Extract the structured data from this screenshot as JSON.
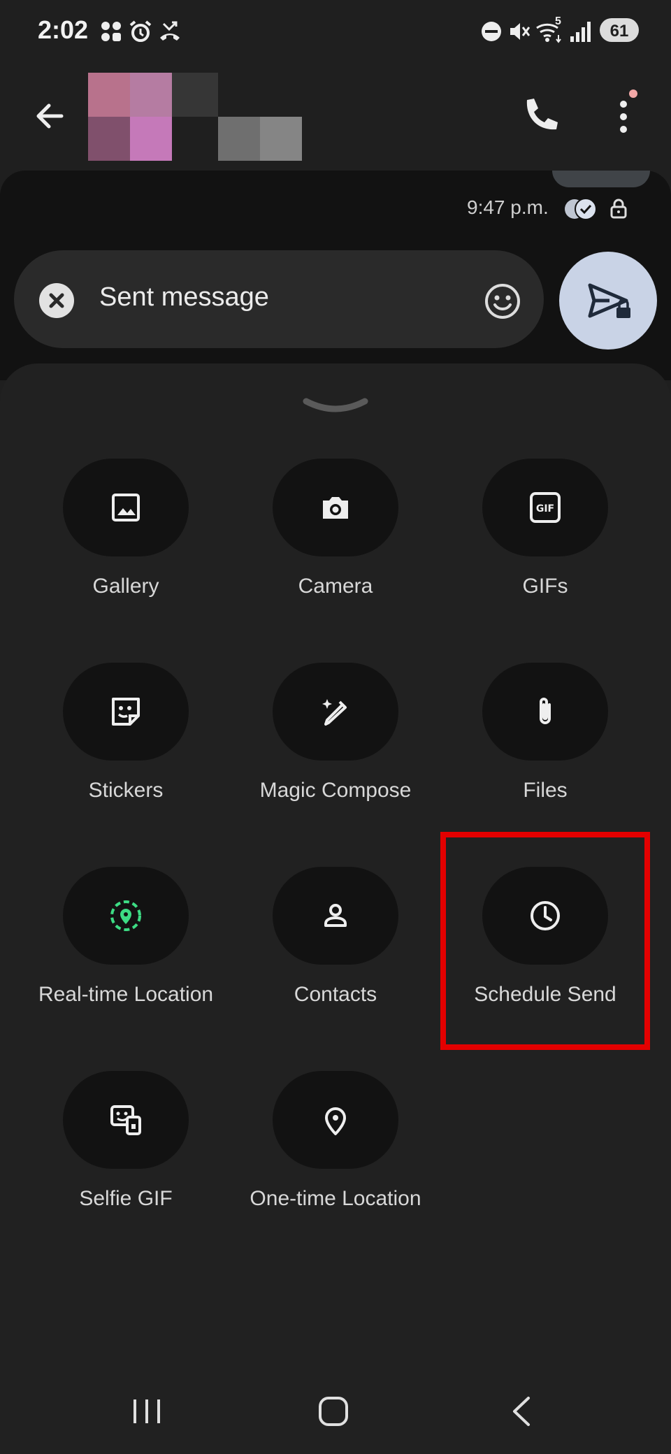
{
  "status_bar": {
    "time": "2:02",
    "wifi_badge": "5",
    "battery": "61",
    "icons_left": [
      "grid-icon",
      "alarm-icon",
      "missed-call-icon"
    ],
    "icons_right": [
      "dnd-icon",
      "mute-icon",
      "wifi-icon",
      "signal-icon",
      "battery-icon"
    ]
  },
  "app_bar": {
    "back_icon": "arrow-left-icon",
    "call_icon": "phone-icon",
    "more_icon": "more-vertical-icon"
  },
  "conversation": {
    "last_message_time": "9:47 p.m.",
    "receipt_icon": "read-receipt-icon",
    "encryption_icon": "lock-icon"
  },
  "compose": {
    "text": "Sent message",
    "clear_icon": "close-icon",
    "emoji_icon": "emoji-icon",
    "send_icon": "send-secure-icon"
  },
  "attach_menu": {
    "handle_icon": "chevron-down-icon",
    "items": [
      {
        "label": "Gallery",
        "icon": "image-icon"
      },
      {
        "label": "Camera",
        "icon": "camera-icon"
      },
      {
        "label": "GIFs",
        "icon": "gif-icon"
      },
      {
        "label": "Stickers",
        "icon": "sticker-icon"
      },
      {
        "label": "Magic Compose",
        "icon": "magic-pen-icon"
      },
      {
        "label": "Files",
        "icon": "paperclip-icon"
      },
      {
        "label": "Real-time Location",
        "icon": "live-location-icon"
      },
      {
        "label": "Contacts",
        "icon": "person-icon"
      },
      {
        "label": "Schedule Send",
        "icon": "clock-icon"
      },
      {
        "label": "Selfie GIF",
        "icon": "selfie-gif-icon"
      },
      {
        "label": "One-time Location",
        "icon": "location-pin-icon"
      }
    ]
  },
  "colors": {
    "background": "#1f1f1f",
    "sheet": "#212121",
    "tile": "#121212",
    "send_button": "#c9d3e6",
    "highlight": "#e30000",
    "live_location": "#3ddc84"
  },
  "nav_bar": {
    "recents_icon": "recents-icon",
    "home_icon": "home-icon",
    "back_icon": "nav-back-icon"
  }
}
